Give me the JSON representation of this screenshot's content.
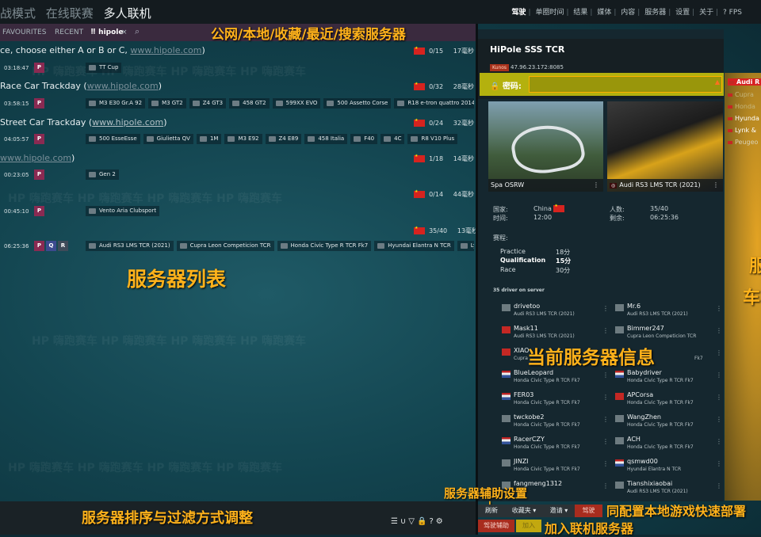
{
  "topbar": {
    "modes": [
      "战模式",
      "在线联赛",
      "多人联机"
    ],
    "active_mode": "多人联机",
    "nav": [
      "驾驶",
      "单圈时间",
      "结果",
      "媒体",
      "内容",
      "服务器",
      "设置",
      "关于",
      "? FPS"
    ]
  },
  "tabs": {
    "favourites": "FAVOURITES",
    "recent": "RECENT",
    "hipole": "hipole",
    "close": "×"
  },
  "servers": [
    {
      "title": "ce, choose either A or B or C, ",
      "link": "www.hipole.com",
      "suffix": ")",
      "players": "0/15",
      "ping": "17毫秒",
      "time": "03:18:47",
      "badges": [
        "P"
      ],
      "cars": [
        "TT Cup"
      ]
    },
    {
      "title": "Race Car Trackday (",
      "link": "www.hipole.com",
      "suffix": ")",
      "players": "0/32",
      "ping": "28毫秒",
      "time": "03:58:15",
      "badges": [
        "P"
      ],
      "cars": [
        "M3 E30 Gr.A 92",
        "M3 GT2",
        "Z4 GT3",
        "458 GT2",
        "599XX EVO",
        "500 Assetto Corse",
        "R18 e-tron quattro 2014"
      ]
    },
    {
      "title": "Street Car Trackday (",
      "link": "www.hipole.com",
      "suffix": ")",
      "players": "0/24",
      "ping": "32毫秒",
      "time": "04:05:57",
      "badges": [
        "P"
      ],
      "cars": [
        "500 EsseEsse",
        "Giulietta QV",
        "1M",
        "M3 E92",
        "Z4 E89",
        "458 Italia",
        "F40",
        "4C",
        "R8 V10 Plus"
      ]
    },
    {
      "title": "",
      "link": "www.hipole.com",
      "suffix": ")",
      "players": "1/18",
      "ping": "14毫秒",
      "time": "00:23:05",
      "badges": [
        "P"
      ],
      "cars": [
        "Gen 2"
      ]
    },
    {
      "title": "",
      "link": "",
      "suffix": "",
      "players": "0/14",
      "ping": "44毫秒",
      "time": "00:45:10",
      "badges": [
        "P"
      ],
      "cars": [
        "Vento Aria Clubsport"
      ]
    },
    {
      "title": "",
      "link": "",
      "suffix": "",
      "players": "35/40",
      "ping": "13毫秒",
      "time": "06:25:36",
      "badges": [
        "P",
        "Q",
        "R"
      ],
      "cars": [
        "Audi RS3 LMS TCR (2021)",
        "Cupra Leon Competicion TCR",
        "Honda Civic Type R TCR Fk7",
        "Hyundai Elantra N TCR",
        "Ly"
      ]
    }
  ],
  "annotations": {
    "top_filter": "公网/本地/收藏/最近/搜索服务器",
    "server_list": "服务器列表",
    "current_info": "当前服务器信息",
    "sort_filter": "服务器排序与过滤方式调整",
    "assist_settings": "服务器辅助设置",
    "quick_deploy": "同配置本地游戏快速部署",
    "join": "加入联机服务器",
    "car_selection": "服",
    "car_selection2": "车"
  },
  "panel": {
    "server_name": "HiPole SSS TCR",
    "kunos": "Kunos",
    "ip": "47.96.23.172:8085",
    "password_label": "密码:",
    "track_name": "Spa OSRW",
    "car_name": "Audi RS3 LMS TCR (2021)",
    "country_label": "国家:",
    "country": "China",
    "time_label": "时间:",
    "time": "12:00",
    "players_label": "人数:",
    "players": "35/40",
    "remaining_label": "剩余:",
    "remaining": "06:25:36",
    "sessions_label": "赛程:",
    "sessions": [
      {
        "name": "Practice",
        "duration": "18分",
        "bold": false
      },
      {
        "name": "Qualification",
        "duration": "15分",
        "bold": true
      },
      {
        "name": "Race",
        "duration": "30分",
        "bold": false
      }
    ],
    "drivers_header": "35 driver on server",
    "drivers": [
      {
        "name": "drivetoo",
        "car": "Audi RS3 LMS TCR (2021)",
        "flag": "gray"
      },
      {
        "name": "Mr.6",
        "car": "Audi RS3 LMS TCR (2021)",
        "flag": "gray"
      },
      {
        "name": "Mask11",
        "car": "Audi RS3 LMS TCR (2021)",
        "flag": "cn"
      },
      {
        "name": "Bimmer247",
        "car": "Cupra Leon Competicion TCR",
        "flag": "gray"
      },
      {
        "name": "XIAO",
        "car": "Cupra",
        "flag": "cn"
      },
      {
        "name": "",
        "car": "Fk7",
        "flag": "none"
      },
      {
        "name": "BlueLeopard",
        "car": "Honda Civic Type R TCR Fk7",
        "flag": "us"
      },
      {
        "name": "Babydriver",
        "car": "Honda Civic Type R TCR Fk7",
        "flag": "us"
      },
      {
        "name": "FER03",
        "car": "Honda Civic Type R TCR Fk7",
        "flag": "us"
      },
      {
        "name": "APCorsa",
        "car": "Honda Civic Type R TCR Fk7",
        "flag": "cn"
      },
      {
        "name": "twckobe2",
        "car": "Honda Civic Type R TCR Fk7",
        "flag": "gray"
      },
      {
        "name": "WangZhen",
        "car": "Honda Civic Type R TCR Fk7",
        "flag": "gray"
      },
      {
        "name": "RacerCZY",
        "car": "Honda Civic Type R TCR Fk7",
        "flag": "us"
      },
      {
        "name": "ACH",
        "car": "Honda Civic Type R TCR Fk7",
        "flag": "gray"
      },
      {
        "name": "JINZI",
        "car": "Honda Civic Type R TCR Fk7",
        "flag": "gray"
      },
      {
        "name": "qsmwd00",
        "car": "Hyundai Elantra N TCR",
        "flag": "us"
      },
      {
        "name": "fangmeng1312",
        "car": "",
        "flag": "gray"
      },
      {
        "name": "Tianshixiaobai",
        "car": "Audi RS3 LMS TCR (2021)",
        "flag": "gray"
      }
    ],
    "buttons": {
      "refresh": "刷新",
      "favorites": "收藏夹",
      "invite": "邀请",
      "drive": "驾驶",
      "assist": "驾驶辅助",
      "join": "加入"
    }
  },
  "right_list": [
    "Audi R",
    "Cupra",
    "Honda",
    "Hyunda",
    "Lynk &",
    "Peugeo"
  ],
  "bottom_icons": [
    "list-icon",
    "u-magnet-icon",
    "filter-icon",
    "lock-icon",
    "question-icon",
    "gear-icon"
  ],
  "colors": {
    "accent": "#ffb21b",
    "badge": "#8a2a52",
    "password_bar": "#b4b10e"
  }
}
